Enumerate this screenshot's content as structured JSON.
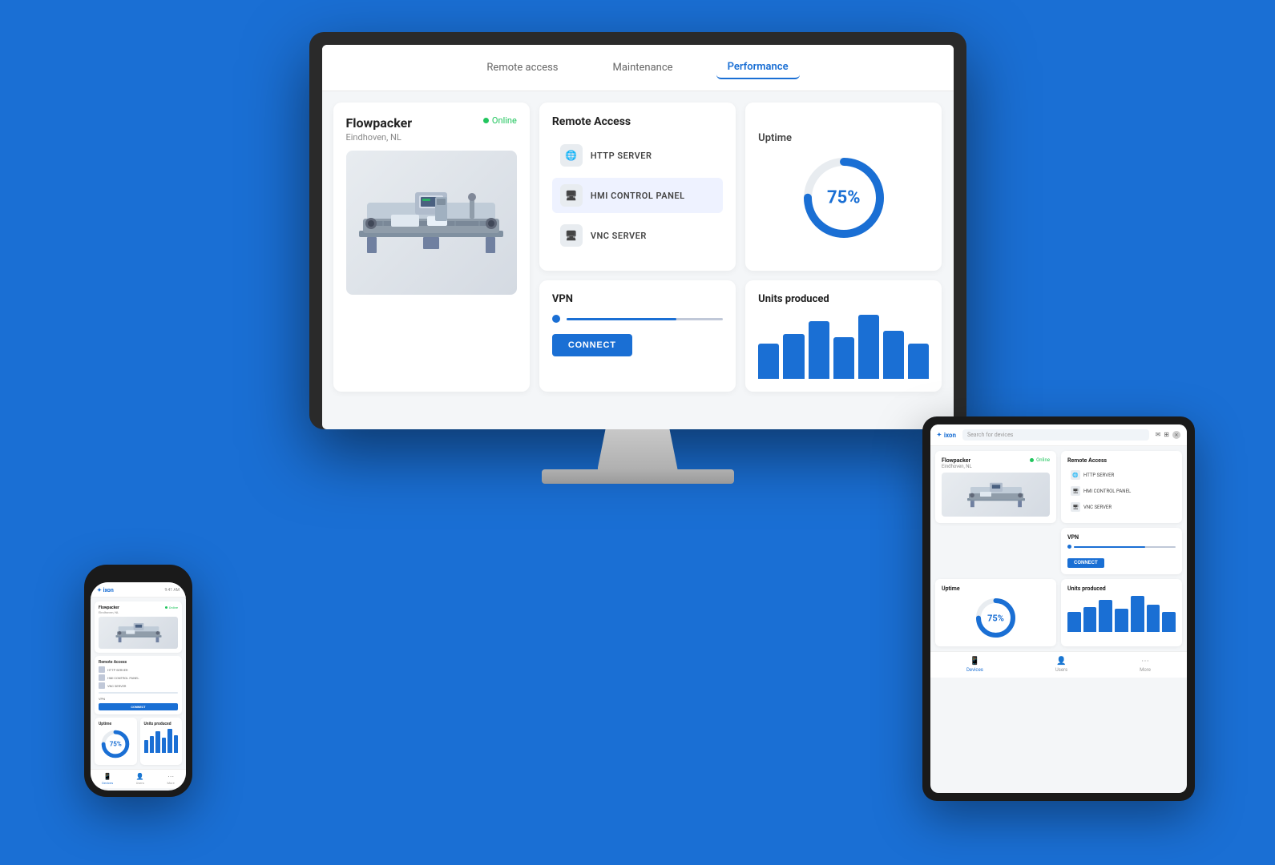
{
  "app": {
    "brand": "ixon",
    "tabs": [
      {
        "label": "Remote access",
        "active": false
      },
      {
        "label": "Maintenance",
        "active": false
      },
      {
        "label": "Performance",
        "active": true
      }
    ]
  },
  "machine": {
    "name": "Flowpacker",
    "location": "Eindhoven, NL",
    "status": "Online"
  },
  "remote_access": {
    "title": "Remote Access",
    "items": [
      {
        "label": "HTTP SERVER",
        "icon": "🌐"
      },
      {
        "label": "HMI CONTROL PANEL",
        "icon": "🖥",
        "selected": true
      },
      {
        "label": "VNC SERVER",
        "icon": "🖥"
      }
    ]
  },
  "uptime": {
    "title": "Uptime",
    "value": 75,
    "label": "75%",
    "circumference": 283
  },
  "vpn": {
    "title": "VPN",
    "connect_label": "CONNECT"
  },
  "units": {
    "title": "Units produced",
    "bars": [
      55,
      70,
      85,
      65,
      90,
      75,
      60
    ]
  },
  "tablet": {
    "search_placeholder": "Search for devices",
    "footer_items": [
      {
        "label": "Devices",
        "active": true
      },
      {
        "label": "Users"
      },
      {
        "label": "More"
      }
    ]
  },
  "phone": {
    "footer_items": [
      {
        "label": "Devices",
        "active": true
      },
      {
        "label": "Users"
      },
      {
        "label": "More"
      }
    ]
  }
}
